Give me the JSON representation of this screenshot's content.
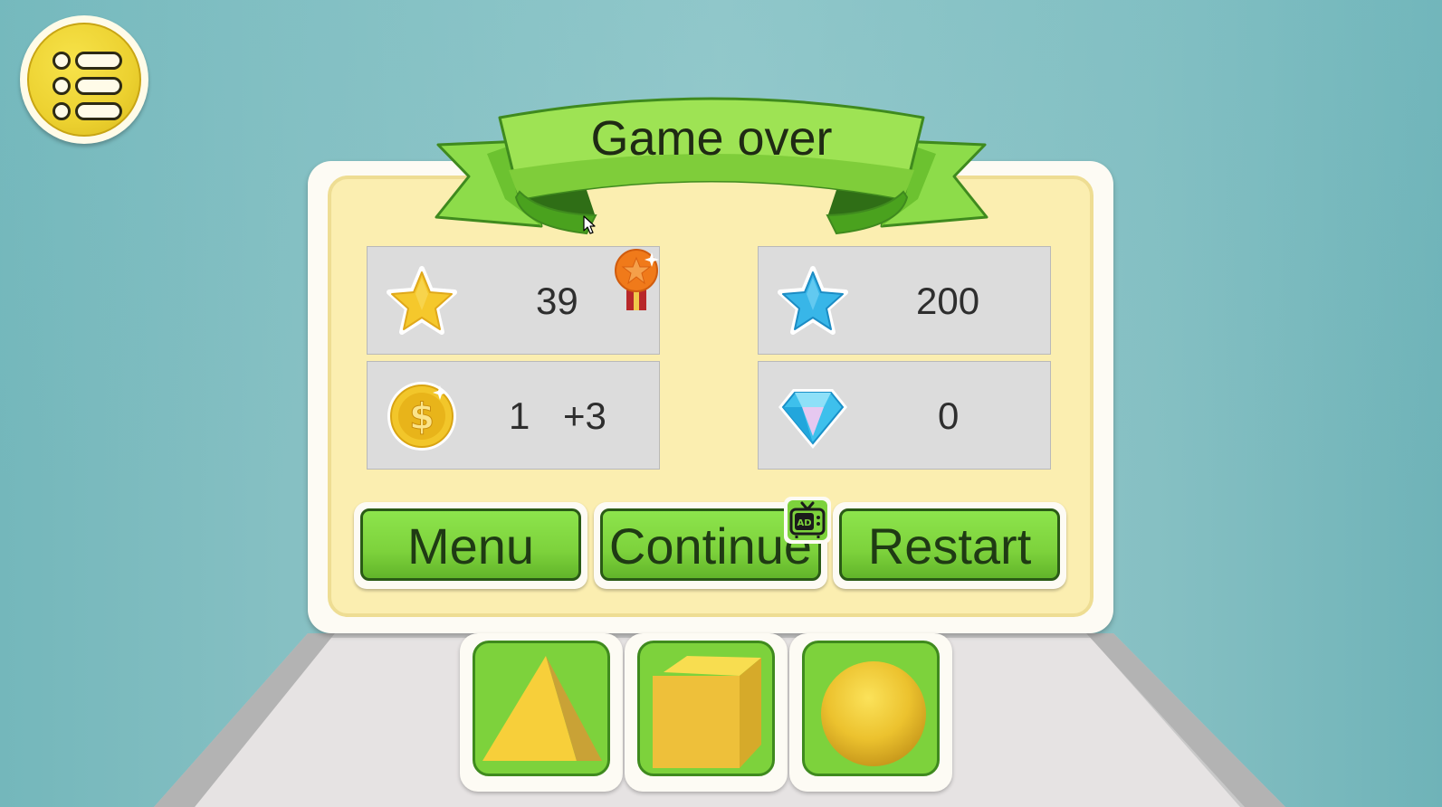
{
  "title": "Game over",
  "stats": {
    "stars": {
      "value": "39",
      "icon": "gold-star-icon"
    },
    "blue_stars": {
      "value": "200",
      "icon": "blue-star-icon"
    },
    "coins": {
      "value": "1",
      "bonus": "+3",
      "icon": "dollar-coin-icon"
    },
    "gems": {
      "value": "0",
      "icon": "diamond-icon"
    },
    "medal_icon": "bronze-medal-icon"
  },
  "buttons": {
    "menu": "Menu",
    "continue": "Continue",
    "restart": "Restart",
    "ad_badge_text": "AD"
  },
  "shapes": [
    "pyramid",
    "cube",
    "sphere"
  ],
  "colors": {
    "button_green": "#7dd23c",
    "ribbon_green": "#8ddc4a",
    "panel_cream": "#fbeeb0",
    "menu_yellow": "#ecd130"
  }
}
